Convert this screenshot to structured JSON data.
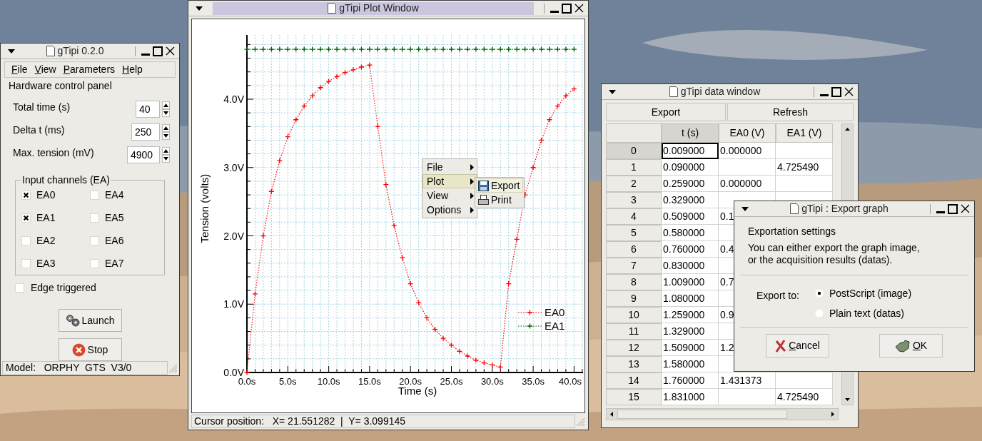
{
  "control_window": {
    "title": "gTipi 0.2.0",
    "menu": [
      "File",
      "View",
      "Parameters",
      "Help"
    ],
    "heading": "Hardware control panel",
    "fields": [
      {
        "label": "Total time (s)",
        "value": "40"
      },
      {
        "label": "Delta t (ms)",
        "value": "250"
      },
      {
        "label": "Max. tension (mV)",
        "value": "4900"
      }
    ],
    "channels_group": {
      "title": "Input channels (EA)",
      "channels": [
        {
          "label": "EA0",
          "checked": true
        },
        {
          "label": "EA1",
          "checked": true
        },
        {
          "label": "EA2",
          "checked": false
        },
        {
          "label": "EA3",
          "checked": false
        },
        {
          "label": "EA4",
          "checked": false
        },
        {
          "label": "EA5",
          "checked": false
        },
        {
          "label": "EA6",
          "checked": false
        },
        {
          "label": "EA7",
          "checked": false
        }
      ]
    },
    "edge_triggered": {
      "label": "Edge triggered",
      "checked": false
    },
    "buttons": [
      {
        "label": "Launch",
        "kind": "launch"
      },
      {
        "label": "Stop",
        "kind": "stop"
      }
    ],
    "status_bar": "Model:   ORPHY  GTS  V3/0"
  },
  "plot_window": {
    "title": "gTipi Plot Window",
    "chart_data": {
      "type": "line",
      "xlabel": "Time (s)",
      "ylabel": "Tension (volts)",
      "x": [
        0,
        1,
        2,
        3,
        4,
        5,
        6,
        7,
        8,
        9,
        10,
        11,
        12,
        13,
        14,
        15,
        16,
        17,
        18,
        19,
        20,
        21,
        22,
        23,
        24,
        25,
        26,
        27,
        28,
        29,
        30,
        31,
        32,
        33,
        34,
        35,
        36,
        37,
        38,
        39,
        40
      ],
      "series": [
        {
          "name": "EA0",
          "color": "#ff0000",
          "line_style": "dotted",
          "marker": "plus",
          "values": [
            0,
            1.15,
            2.0,
            2.65,
            3.1,
            3.45,
            3.7,
            3.9,
            4.05,
            4.17,
            4.26,
            4.33,
            4.39,
            4.43,
            4.47,
            4.5,
            3.6,
            2.75,
            2.15,
            1.68,
            1.3,
            1.02,
            0.8,
            0.63,
            0.5,
            0.4,
            0.31,
            0.24,
            0.18,
            0.14,
            0.11,
            0.08,
            1.3,
            1.95,
            2.6,
            3.0,
            3.4,
            3.7,
            3.9,
            4.05,
            4.15
          ]
        },
        {
          "name": "EA1",
          "color": "#006400",
          "line_style": "dotted",
          "marker": "plus",
          "values": [
            4.73,
            4.73,
            4.73,
            4.73,
            4.73,
            4.73,
            4.73,
            4.73,
            4.73,
            4.73,
            4.73,
            4.73,
            4.73,
            4.73,
            4.73,
            4.73,
            4.73,
            4.73,
            4.73,
            4.73,
            4.73,
            4.73,
            4.73,
            4.73,
            4.73,
            4.73,
            4.73,
            4.73,
            4.73,
            4.73,
            4.73,
            4.73,
            4.73,
            4.73,
            4.73,
            4.73,
            4.73,
            4.73,
            4.73,
            4.73,
            4.73
          ]
        }
      ],
      "xlim": [
        0,
        41.1
      ],
      "ylim": [
        0,
        4.94
      ],
      "grid": true,
      "legend": true,
      "xticks": [
        {
          "value": 0,
          "label": "0.0s"
        },
        {
          "value": 5,
          "label": "5.0s"
        },
        {
          "value": 10,
          "label": "10.0s"
        },
        {
          "value": 15,
          "label": "15.0s"
        },
        {
          "value": 20,
          "label": "20.0s"
        },
        {
          "value": 25,
          "label": "25.0s"
        },
        {
          "value": 30,
          "label": "30.0s"
        },
        {
          "value": 35,
          "label": "35.0s"
        },
        {
          "value": 40,
          "label": "40.0s"
        }
      ],
      "yticks": [
        {
          "value": 0,
          "label": "0.0V"
        },
        {
          "value": 1,
          "label": "1.0V"
        },
        {
          "value": 2,
          "label": "2.0V"
        },
        {
          "value": 3,
          "label": "3.0V"
        },
        {
          "value": 4,
          "label": "4.0V"
        }
      ]
    },
    "context_menu": [
      {
        "label": "File",
        "selected": false
      },
      {
        "label": "Plot",
        "selected": true
      },
      {
        "label": "View",
        "selected": false
      },
      {
        "label": "Options",
        "selected": false
      }
    ],
    "submenu": [
      {
        "label": "Export",
        "kind": "save"
      },
      {
        "label": "Print",
        "kind": "print"
      }
    ],
    "status_bar": "Cursor position:   X= 21.551282  |  Y= 3.099145"
  },
  "data_window": {
    "title": "gTipi data window",
    "buttons": [
      "Export",
      "Refresh"
    ],
    "columns": [
      {
        "label": "t (s)",
        "selected": true
      },
      {
        "label": "EA0 (V)",
        "selected": false
      },
      {
        "label": "EA1 (V)",
        "selected": false
      }
    ],
    "rows": [
      {
        "index": "0",
        "selected": true,
        "t": "0.009000",
        "ea0": "0.000000"
      },
      {
        "index": "1",
        "selected": false,
        "t": "0.090000",
        "ea1": "4.725490"
      },
      {
        "index": "2",
        "selected": false,
        "t": "0.259000",
        "ea0": "0.000000"
      },
      {
        "index": "3",
        "selected": false,
        "t": "0.329000"
      },
      {
        "index": "4",
        "selected": false,
        "t": "0.509000",
        "ea0": "0.1"
      },
      {
        "index": "5",
        "selected": false,
        "t": "0.580000"
      },
      {
        "index": "6",
        "selected": false,
        "t": "0.760000",
        "ea0": "0.4"
      },
      {
        "index": "7",
        "selected": false,
        "t": "0.830000"
      },
      {
        "index": "8",
        "selected": false,
        "t": "1.009000",
        "ea0": "0.7"
      },
      {
        "index": "9",
        "selected": false,
        "t": "1.080000"
      },
      {
        "index": "10",
        "selected": false,
        "t": "1.259000",
        "ea0": "0.9"
      },
      {
        "index": "11",
        "selected": false,
        "t": "1.329000"
      },
      {
        "index": "12",
        "selected": false,
        "t": "1.509000",
        "ea0": "1.2"
      },
      {
        "index": "13",
        "selected": false,
        "t": "1.580000"
      },
      {
        "index": "14",
        "selected": false,
        "t": "1.760000",
        "ea0": "1.431373"
      },
      {
        "index": "15",
        "selected": false,
        "t": "1.831000",
        "ea1": "4.725490"
      }
    ]
  },
  "export_dialog": {
    "title": "gTipi : Export graph",
    "heading": "Exportation settings",
    "text": "You can either export the graph image,\nor the acquisition results (datas).",
    "export_label": "Export to:",
    "options": [
      {
        "label": "PostScript (image)",
        "selected": true
      },
      {
        "label": "Plain text (datas)",
        "selected": false
      }
    ],
    "buttons": [
      {
        "label": "Cancel",
        "kind": "cancel"
      },
      {
        "label": "OK",
        "kind": "ok"
      }
    ]
  }
}
